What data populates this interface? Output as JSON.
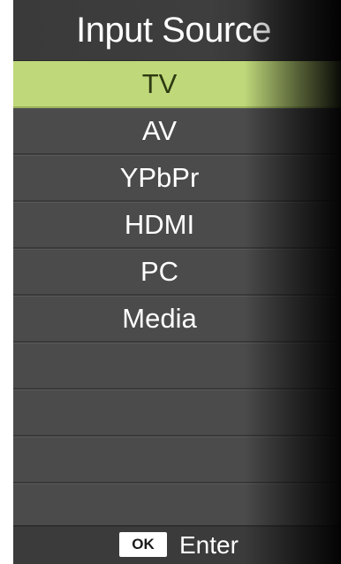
{
  "title": "Input Source",
  "items": [
    {
      "label": "TV",
      "selected": true
    },
    {
      "label": "AV",
      "selected": false
    },
    {
      "label": "YPbPr",
      "selected": false
    },
    {
      "label": "HDMI",
      "selected": false
    },
    {
      "label": "PC",
      "selected": false
    },
    {
      "label": "Media",
      "selected": false
    },
    {
      "label": "",
      "selected": false
    },
    {
      "label": "",
      "selected": false
    },
    {
      "label": "",
      "selected": false
    },
    {
      "label": "",
      "selected": false
    }
  ],
  "footer": {
    "key": "OK",
    "action": "Enter"
  },
  "colors": {
    "selected_bg": "#bfd87a",
    "menu_bg": "#4a4a4a"
  }
}
